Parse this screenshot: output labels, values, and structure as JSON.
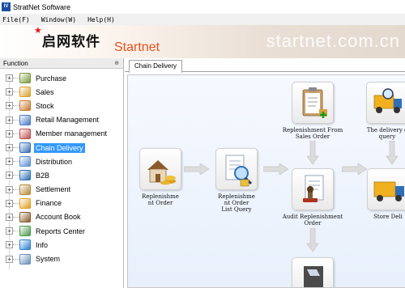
{
  "window": {
    "app_icon_text": "IV",
    "title": "StratNet Software"
  },
  "menu": [
    "File(F)",
    "Window(W)",
    "Help(H)"
  ],
  "banner": {
    "cn_title": "启网软件",
    "en_title": "Startnet",
    "watermark": "startnet.com.cn"
  },
  "sidebar": {
    "header": "Function",
    "pin": "⊕",
    "items": [
      {
        "label": "Purchase",
        "icon": "purchase-icon",
        "color": "#7a9a3c"
      },
      {
        "label": "Sales",
        "icon": "sales-icon",
        "color": "#d9a030"
      },
      {
        "label": "Stock",
        "icon": "stock-icon",
        "color": "#c7762a"
      },
      {
        "label": "Retail Management",
        "icon": "retail-icon",
        "color": "#4a7bc4"
      },
      {
        "label": "Member management",
        "icon": "member-icon",
        "color": "#c0504d"
      },
      {
        "label": "Chain Delivery",
        "icon": "truck-icon",
        "color": "#3a6fb5"
      },
      {
        "label": "Distribution",
        "icon": "distribution-icon",
        "color": "#5b8fd1"
      },
      {
        "label": "B2B",
        "icon": "b2b-icon",
        "color": "#2f6fb8"
      },
      {
        "label": "Settlement",
        "icon": "settlement-icon",
        "color": "#b48a3a"
      },
      {
        "label": "Finance",
        "icon": "finance-icon",
        "color": "#e0a020"
      },
      {
        "label": "Account Book",
        "icon": "account-book-icon",
        "color": "#8c5a2b"
      },
      {
        "label": "Reports Center",
        "icon": "reports-icon",
        "color": "#4c9a4c"
      },
      {
        "label": "Info",
        "icon": "info-icon",
        "color": "#2d7fd0"
      },
      {
        "label": "System",
        "icon": "system-icon",
        "color": "#6a8fb8"
      }
    ]
  },
  "tab": {
    "label": "Chain Delivery"
  },
  "flow": {
    "replenishment_order": "Replenishme\nnt Order",
    "replenishment_query": "Replenishme\nnt Order\nList Query",
    "from_sales_order": "Replenishment From\nSales Order",
    "audit": "Audit Replenishment\nOrder",
    "delivery_query": "The delivery o\nquery",
    "store_delivery": "Store Deli"
  }
}
